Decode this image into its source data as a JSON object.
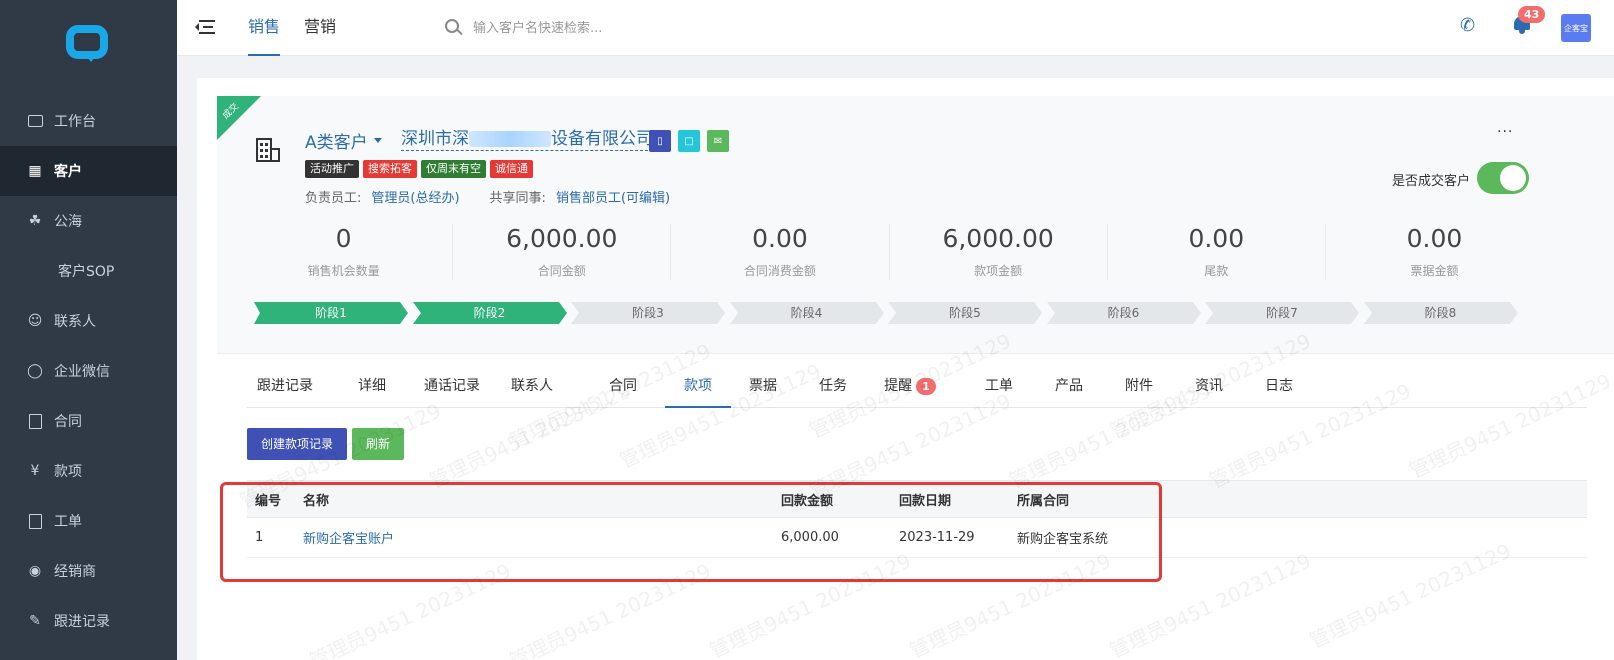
{
  "topbar": {
    "tabs": [
      {
        "label": "销售"
      },
      {
        "label": "营销"
      }
    ],
    "search_placeholder": "输入客户名快速检索...",
    "notification_count": "43",
    "avatar_label": "企客宝"
  },
  "sidebar": {
    "items": [
      {
        "label": "工作台",
        "icon": "monitor-icon"
      },
      {
        "label": "客户",
        "icon": "building-icon",
        "active": true
      },
      {
        "label": "公海",
        "icon": "sea-icon"
      },
      {
        "label": "客户SOP",
        "icon": "sop-icon"
      },
      {
        "label": "联系人",
        "icon": "contact-icon"
      },
      {
        "label": "企业微信",
        "icon": "wechat-icon"
      },
      {
        "label": "合同",
        "icon": "contract-icon"
      },
      {
        "label": "款项",
        "icon": "yen-icon"
      },
      {
        "label": "工单",
        "icon": "clipboard-icon"
      },
      {
        "label": "经销商",
        "icon": "dealer-icon"
      },
      {
        "label": "跟进记录",
        "icon": "edit-icon"
      }
    ]
  },
  "customer": {
    "ribbon": "成交",
    "class_label": "A类客户",
    "name_prefix": "深圳市深",
    "name_suffix": "设备有限公司",
    "tags": [
      {
        "label": "活动推广",
        "color": "#333333"
      },
      {
        "label": "搜索拓客",
        "color": "#e53935"
      },
      {
        "label": "仅周末有空",
        "color": "#2e7d32"
      },
      {
        "label": "诚信通",
        "color": "#e53935"
      }
    ],
    "owner_label": "负责员工:",
    "owner_value": "管理员(总经办)",
    "share_label": "共享同事:",
    "share_value": "销售部员工(可编辑)",
    "more": "···",
    "deal_label": "是否成交客户",
    "deal_on": true
  },
  "stats": [
    {
      "value": "0",
      "label": "销售机会数量"
    },
    {
      "value": "6,000.00",
      "label": "合同金额"
    },
    {
      "value": "0.00",
      "label": "合同消费金额"
    },
    {
      "value": "6,000.00",
      "label": "款项金额"
    },
    {
      "value": "0.00",
      "label": "尾款"
    },
    {
      "value": "0.00",
      "label": "票据金额"
    }
  ],
  "stages": [
    {
      "label": "阶段1",
      "done": true
    },
    {
      "label": "阶段2",
      "done": true
    },
    {
      "label": "阶段3",
      "done": false
    },
    {
      "label": "阶段4",
      "done": false
    },
    {
      "label": "阶段5",
      "done": false
    },
    {
      "label": "阶段6",
      "done": false
    },
    {
      "label": "阶段7",
      "done": false
    },
    {
      "label": "阶段8",
      "done": false
    }
  ],
  "tabs": [
    {
      "label": "跟进记录"
    },
    {
      "label": "详细"
    },
    {
      "label": "通话记录"
    },
    {
      "label": "联系人"
    },
    {
      "label": "合同"
    },
    {
      "label": "款项",
      "active": true
    },
    {
      "label": "票据"
    },
    {
      "label": "任务"
    },
    {
      "label": "提醒",
      "badge": "1"
    },
    {
      "label": "工单"
    },
    {
      "label": "产品"
    },
    {
      "label": "附件"
    },
    {
      "label": "资讯"
    },
    {
      "label": "日志"
    }
  ],
  "buttons": {
    "create": "创建款项记录",
    "refresh": "刷新"
  },
  "table": {
    "headers": [
      "编号",
      "名称",
      "回款金额",
      "回款日期",
      "所属合同"
    ],
    "rows": [
      [
        "1",
        "新购企客宝账户",
        "6,000.00",
        "2023-11-29",
        "新购企客宝系统"
      ]
    ]
  },
  "watermark": "管理员9451 20231129",
  "colors": {
    "accent": "#2b6cb0",
    "sidebar": "#2f3a46",
    "stage_done": "#2fb37b",
    "highlight": "#e53935"
  }
}
